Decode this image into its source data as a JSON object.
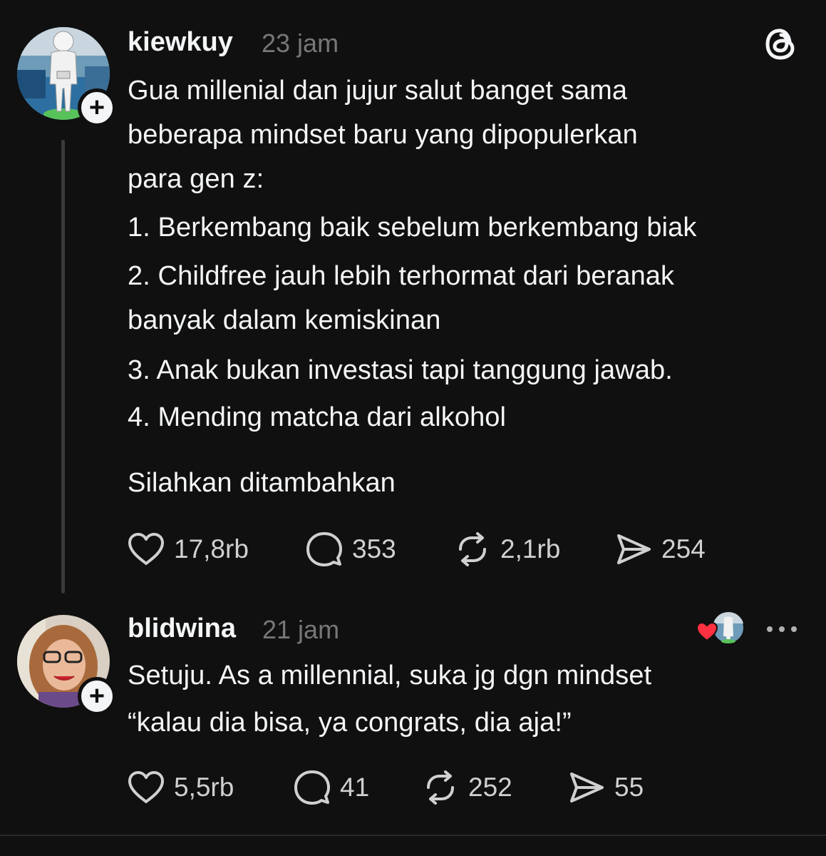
{
  "posts": [
    {
      "username": "kiewkuy",
      "time": "23 jam",
      "lines": [
        "Gua millenial dan jujur salut banget sama",
        "beberapa mindset baru yang dipopulerkan",
        "para gen z:",
        "1. Berkembang baik sebelum berkembang biak",
        "2. Childfree jauh lebih terhormat dari beranak",
        "banyak dalam kemiskinan",
        "3. Anak bukan investasi tapi tanggung jawab.",
        "4. Mending matcha dari alkohol",
        "Silahkan ditambahkan"
      ],
      "likes": "17,8rb",
      "replies": "353",
      "reposts": "2,1rb",
      "shares": "254"
    },
    {
      "username": "blidwina",
      "time": "21 jam",
      "lines": [
        "Setuju. As a millennial, suka jg dgn mindset",
        "“kalau dia bisa, ya congrats, dia aja!”"
      ],
      "likes": "5,5rb",
      "replies": "41",
      "reposts": "252",
      "shares": "55"
    }
  ],
  "icons": {
    "app_logo": "threads-logo-icon",
    "like": "heart-icon",
    "reply": "speech-bubble-icon",
    "repost": "repost-icon",
    "share": "send-icon",
    "more": "more-dots-icon",
    "liked_by_author": "heart-filled-icon"
  },
  "colors": {
    "background": "#101010",
    "text": "#f3f5f7",
    "muted": "#777777",
    "like_red": "#ff3040"
  }
}
